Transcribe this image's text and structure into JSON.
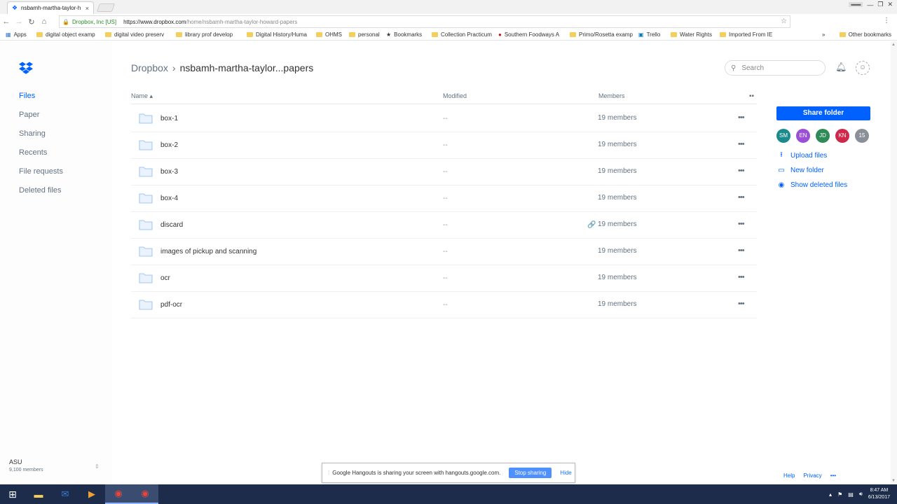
{
  "browser": {
    "tab_title": "nsbamh-martha-taylor-h",
    "org": "Dropbox, Inc [US]",
    "url_host": "https://www.dropbox.com",
    "url_path": "/home/nsbamh-martha-taylor-howard-papers",
    "bookmarks": [
      {
        "label": "Apps"
      },
      {
        "label": "digital object examp"
      },
      {
        "label": "digital video preserv"
      },
      {
        "label": "library prof develop"
      },
      {
        "label": "Digital History/Huma"
      },
      {
        "label": "OHMS"
      },
      {
        "label": "personal"
      },
      {
        "label": "Bookmarks"
      },
      {
        "label": "Collection Practicum"
      },
      {
        "label": "Southern Foodways A"
      },
      {
        "label": "Primo/Rosetta examp"
      },
      {
        "label": "Trello"
      },
      {
        "label": "Water Rights"
      },
      {
        "label": "Imported From IE"
      }
    ],
    "more_bookmarks": "»",
    "other_bookmarks": "Other bookmarks"
  },
  "sidebar": {
    "items": [
      {
        "label": "Files",
        "active": true
      },
      {
        "label": "Paper"
      },
      {
        "label": "Sharing"
      },
      {
        "label": "Recents"
      },
      {
        "label": "File requests"
      },
      {
        "label": "Deleted files"
      }
    ],
    "team_name": "ASU",
    "team_members": "9,100 members"
  },
  "header": {
    "breadcrumb_root": "Dropbox",
    "breadcrumb_sep": "›",
    "breadcrumb_current": "nsbamh-martha-taylor...papers",
    "search_placeholder": "Search"
  },
  "table": {
    "col_name": "Name ▴",
    "col_modified": "Modified",
    "col_members": "Members",
    "rows": [
      {
        "name": "box-1",
        "modified": "--",
        "members": "19 members"
      },
      {
        "name": "box-2",
        "modified": "--",
        "members": "19 members"
      },
      {
        "name": "box-3",
        "modified": "--",
        "members": "19 members"
      },
      {
        "name": "box-4",
        "modified": "--",
        "members": "19 members"
      },
      {
        "name": "discard",
        "modified": "--",
        "members": "19 members",
        "link": "🔗"
      },
      {
        "name": "images of pickup and scanning",
        "modified": "--",
        "members": "19 members"
      },
      {
        "name": "ocr",
        "modified": "--",
        "members": "19 members"
      },
      {
        "name": "pdf-ocr",
        "modified": "--",
        "members": "19 members"
      }
    ],
    "more_glyph": "•••"
  },
  "right_panel": {
    "share_button": "Share folder",
    "avatars": [
      {
        "initials": "SM",
        "color": "#1a8a8a"
      },
      {
        "initials": "EN",
        "color": "#9b4fd6"
      },
      {
        "initials": "JD",
        "color": "#2e8b57"
      },
      {
        "initials": "KN",
        "color": "#d0284b"
      },
      {
        "initials": "15",
        "color": "#8a9099"
      }
    ],
    "actions": {
      "upload": "Upload files",
      "new_folder": "New folder",
      "show_deleted": "Show deleted files"
    }
  },
  "footer": {
    "help": "Help",
    "privacy": "Privacy",
    "more": "•••"
  },
  "hangouts_bar": {
    "message": "Google Hangouts is sharing your screen with hangouts.google.com.",
    "stop": "Stop sharing",
    "hide": "Hide"
  },
  "taskbar": {
    "time": "8:47 AM",
    "date": "6/13/2017"
  },
  "colors": {
    "accent": "#0061fe"
  }
}
